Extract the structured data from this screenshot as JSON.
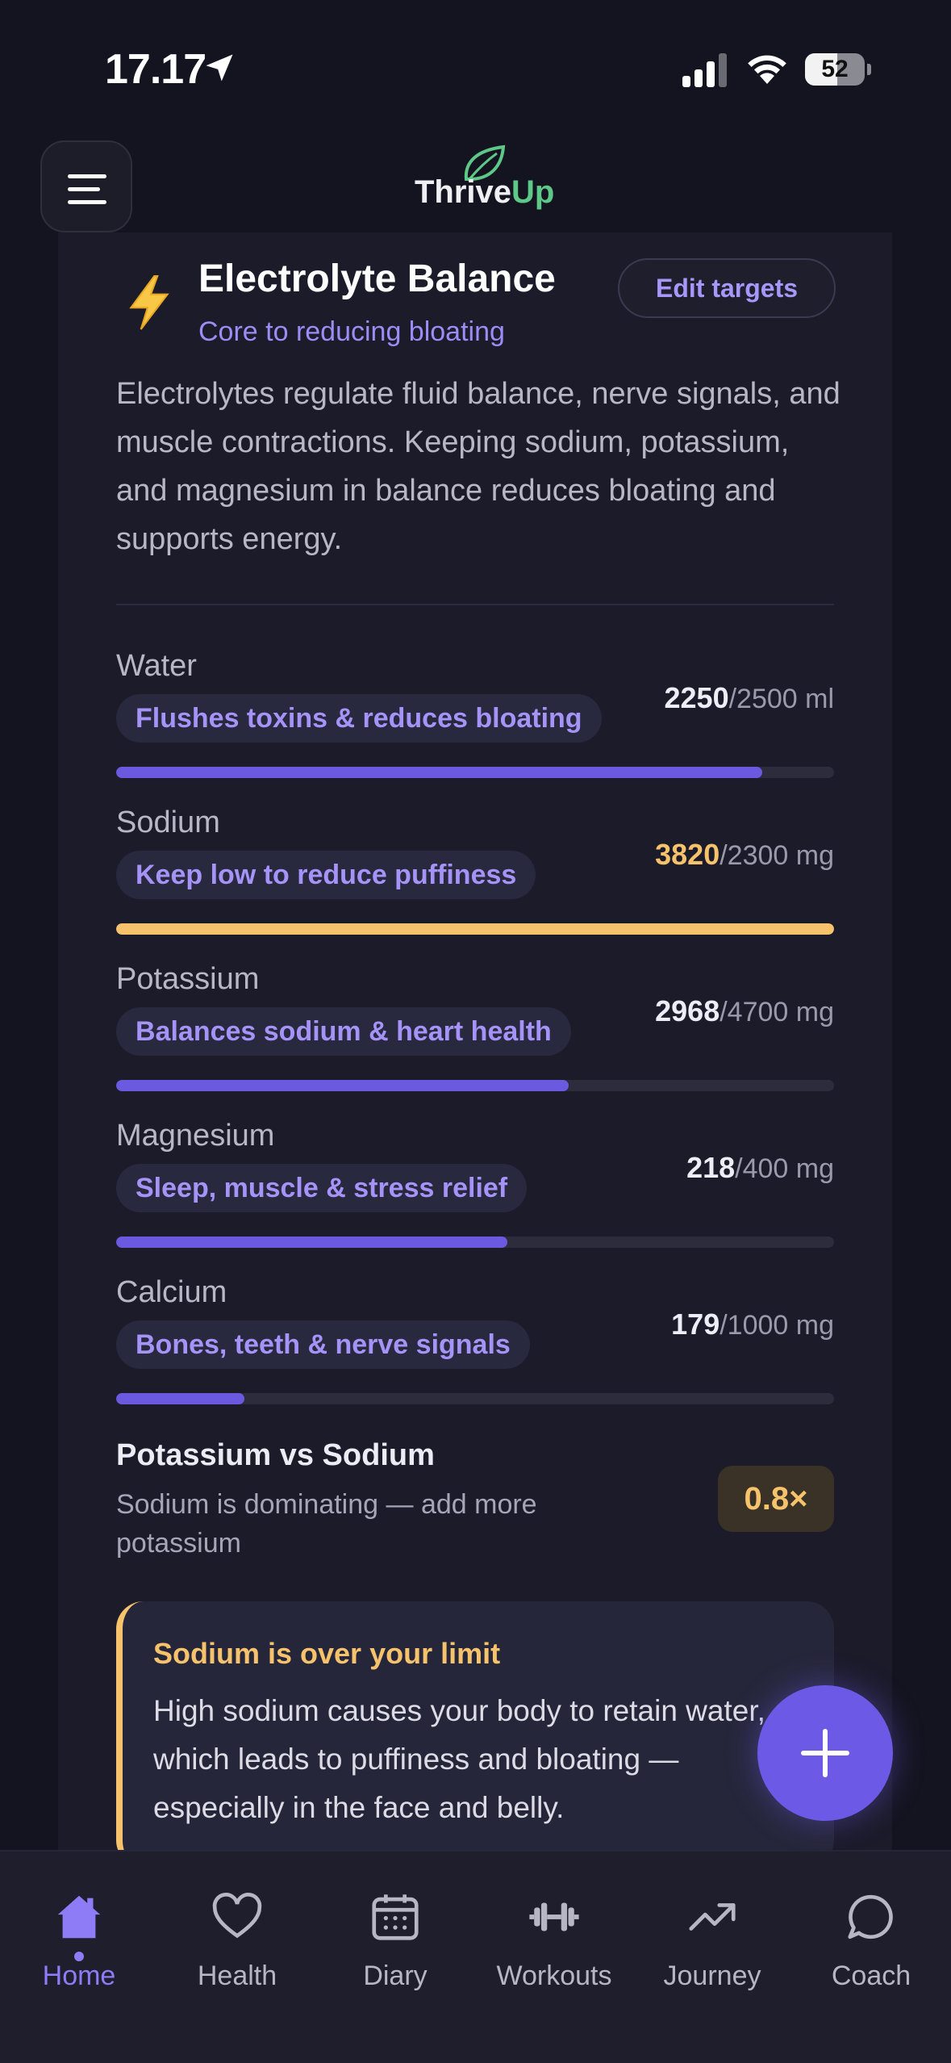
{
  "status_bar": {
    "time": "17.17",
    "battery": "52"
  },
  "header": {
    "logo_part1": "Thrive",
    "logo_part2": "Up"
  },
  "card": {
    "title": "Electrolyte Balance",
    "subtitle": "Core to reducing bloating",
    "edit_label": "Edit targets",
    "description": "Electrolytes regulate fluid balance, nerve signals, and muscle contractions. Keeping sodium, potassium, and magnesium in balance reduces bloating and supports energy."
  },
  "nutrients": [
    {
      "name": "Water",
      "tag": "Flushes toxins & reduces bloating",
      "current": "2250",
      "target": "/2500 ml",
      "progress": 0.9,
      "warn": false
    },
    {
      "name": "Sodium",
      "tag": "Keep low to reduce puffiness",
      "current": "3820",
      "target": "/2300 mg",
      "progress": 1.0,
      "warn": true
    },
    {
      "name": "Potassium",
      "tag": "Balances sodium & heart health",
      "current": "2968",
      "target": "/4700 mg",
      "progress": 0.63,
      "warn": false
    },
    {
      "name": "Magnesium",
      "tag": "Sleep, muscle & stress relief",
      "current": "218",
      "target": "/400 mg",
      "progress": 0.545,
      "warn": false
    },
    {
      "name": "Calcium",
      "tag": "Bones, teeth & nerve signals",
      "current": "179",
      "target": "/1000 mg",
      "progress": 0.179,
      "warn": false
    }
  ],
  "ratio": {
    "title": "Potassium vs Sodium",
    "subtitle": "Sodium is dominating — add more potassium",
    "value": "0.8×"
  },
  "alert": {
    "title": "Sodium is over your limit",
    "body": "High sodium causes your body to retain water, which leads to puffiness and bloating — especially in the face and belly."
  },
  "nav": {
    "items": [
      {
        "label": "Home",
        "icon": "home-icon"
      },
      {
        "label": "Health",
        "icon": "heart-icon"
      },
      {
        "label": "Diary",
        "icon": "calendar-icon"
      },
      {
        "label": "Workouts",
        "icon": "dumbbell-icon"
      },
      {
        "label": "Journey",
        "icon": "trend-icon"
      },
      {
        "label": "Coach",
        "icon": "chat-icon"
      }
    ],
    "active": "Home"
  },
  "colors": {
    "accent": "#6C5AE6",
    "warning": "#F6C36C",
    "brand_green": "#5DC887"
  }
}
